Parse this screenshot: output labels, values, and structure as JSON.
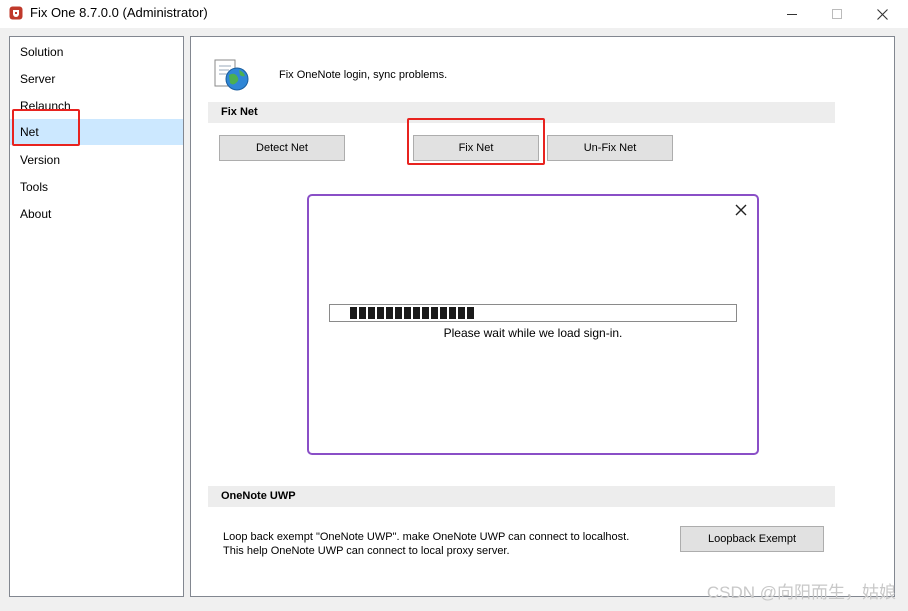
{
  "window": {
    "title": "Fix One 8.7.0.0 (Administrator)"
  },
  "sidebar": {
    "items": [
      {
        "label": "Solution"
      },
      {
        "label": "Server"
      },
      {
        "label": "Relaunch"
      },
      {
        "label": "Net",
        "selected": true
      },
      {
        "label": "Version"
      },
      {
        "label": "Tools"
      },
      {
        "label": "About"
      }
    ]
  },
  "main": {
    "description": "Fix OneNote login, sync problems.",
    "fix_net_section": {
      "header": "Fix Net",
      "buttons": {
        "detect": "Detect Net",
        "fix": "Fix Net",
        "unfix": "Un-Fix Net"
      }
    },
    "dialog": {
      "progress_text": "Please wait while we load sign-in.",
      "progress_blocks": 14
    },
    "uwp_section": {
      "header": "OneNote UWP",
      "description_line1": "Loop back exempt \"OneNote UWP\". make OneNote UWP can connect to localhost.",
      "description_line2": "This help OneNote UWP can connect to local proxy server.",
      "button": "Loopback Exempt"
    }
  },
  "watermark": "CSDN @向阳而生，姑娘",
  "colors": {
    "selection": "#cce8ff",
    "highlight": "#e8231f",
    "dialog_border": "#8a4fc7"
  }
}
